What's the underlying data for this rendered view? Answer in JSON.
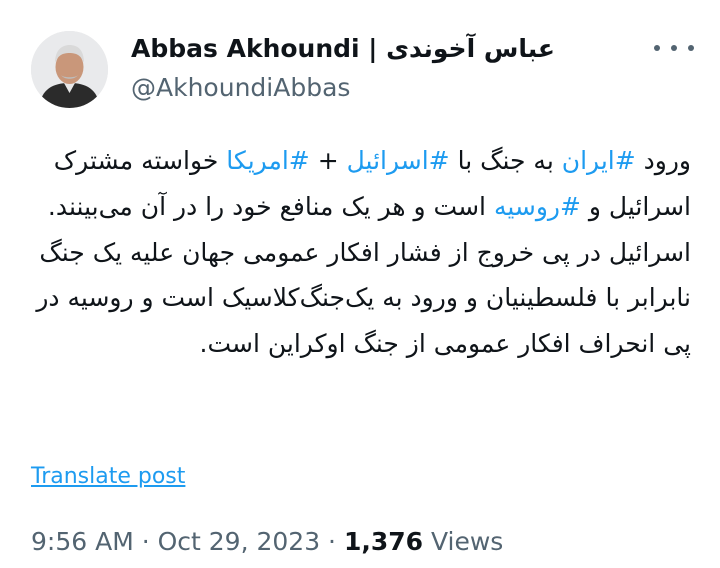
{
  "author": {
    "display_name": "Abbas Akhoundi | عباس آخوندی",
    "handle": "@AkhoundiAbbas"
  },
  "tweet": {
    "paragraph1": [
      {
        "text": "ورود ",
        "tag": false
      },
      {
        "text": "#ایران",
        "tag": true
      },
      {
        "text": " به جنگ با ",
        "tag": false
      },
      {
        "text": "#اسرائیل",
        "tag": true
      },
      {
        "text": " + ",
        "tag": false
      },
      {
        "text": "#امریکا",
        "tag": true
      },
      {
        "text": " خواسته مشترک اسرائیل و ",
        "tag": false
      },
      {
        "text": "#روسیه",
        "tag": true
      },
      {
        "text": " است و هر یک منافع خود را در آن می‌بینند.",
        "tag": false
      }
    ],
    "paragraph2": "اسرائیل در پی خروج از فشار افکار عمومی جهان علیه یک جنگ نابرابر با فلسطینیان و ورود به یک‌جنگ‌کلاسیک است و روسیه در پی انحراف افکار عمومی از جنگ اوکراین است."
  },
  "translate_label": "Translate post",
  "meta": {
    "time": "9:56 AM",
    "date": "Oct 29, 2023",
    "separator": " · ",
    "views_count": "1,376",
    "views_label": " Views"
  },
  "colors": {
    "link": "#1d9bf0",
    "secondary_text": "#536471",
    "primary_text": "#0f1419"
  }
}
